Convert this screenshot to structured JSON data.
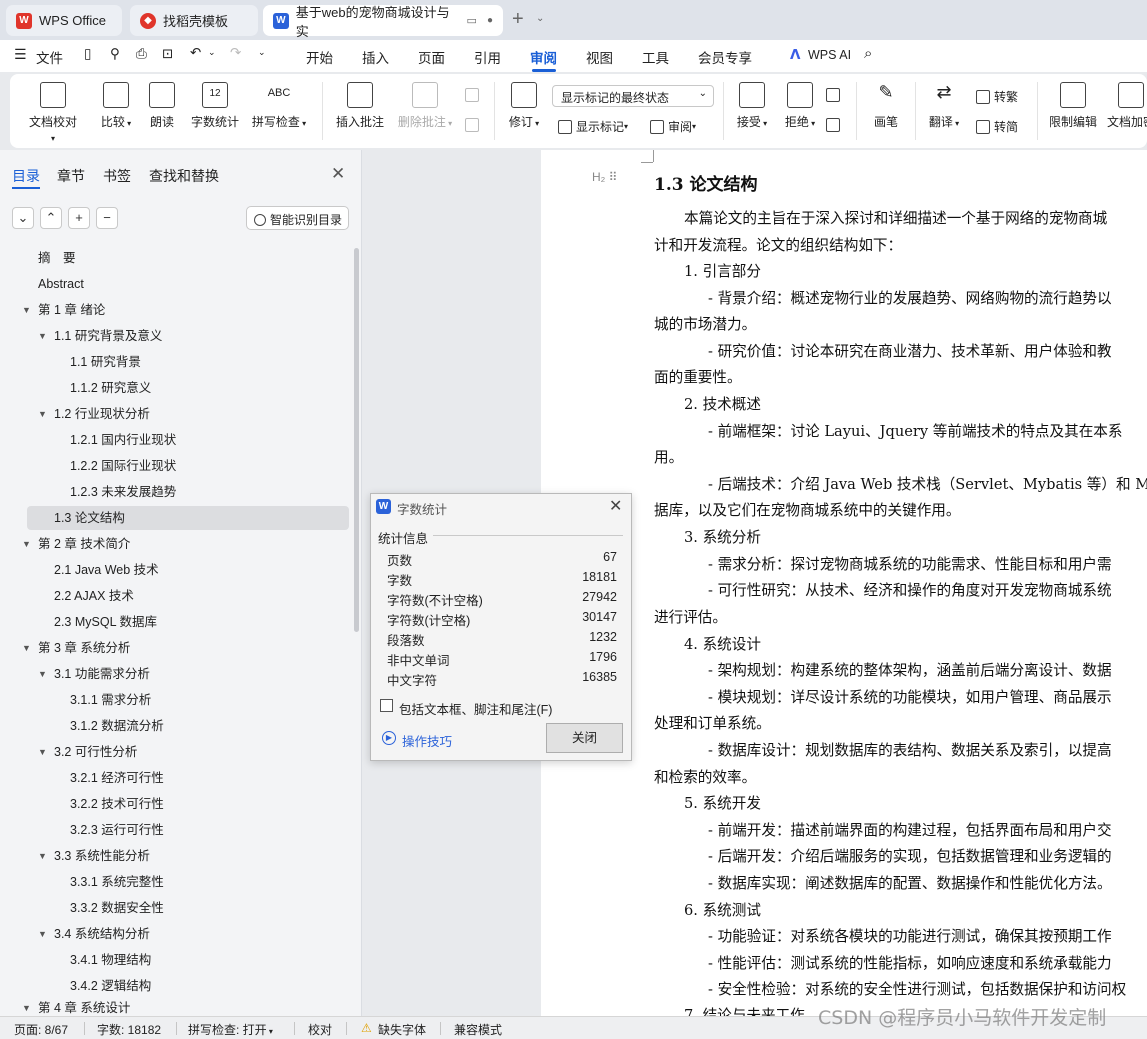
{
  "tabs": {
    "wps": "WPS Office",
    "template": "找稻壳模板",
    "doc": "基于web的宠物商城设计与实"
  },
  "menu": {
    "file": "文件",
    "items": [
      "开始",
      "插入",
      "页面",
      "引用",
      "审阅",
      "视图",
      "工具",
      "会员专享"
    ],
    "active": "审阅",
    "wps_ai": "WPS AI"
  },
  "ribbon": {
    "doc_check": "文档校对",
    "compare": "比较",
    "read_aloud": "朗读",
    "word_count": "字数统计",
    "spell_check": "拼写检查",
    "insert_comment": "插入批注",
    "delete_comment": "删除批注",
    "revise": "修订",
    "markup_select": "显示标记的最终状态",
    "show_markup": "显示标记",
    "review": "审阅",
    "accept": "接受",
    "reject": "拒绝",
    "pen": "画笔",
    "translate": "翻译",
    "to_traditional": "转繁",
    "to_simplified": "转简",
    "restrict_edit": "限制编辑",
    "doc_encrypt": "文档加密"
  },
  "nav": {
    "tabs": [
      "目录",
      "章节",
      "书签",
      "查找和替换"
    ],
    "smart_toc": "智能识别目录",
    "toc": [
      "摘　要",
      "Abstract",
      "第 1 章  绪论",
      "1.1 研究背景及意义",
      "1.1 研究背景",
      "1.1.2 研究意义",
      "1.2  行业现状分析",
      "1.2.1  国内行业现状",
      "1.2.2  国际行业现状",
      "1.2.3  未来发展趋势",
      "1.3 论文结构",
      "第 2 章  技术简介",
      "2.1 Java Web 技术",
      "2.2 AJAX 技术",
      "2.3 MySQL 数据库",
      "第 3 章  系统分析",
      "3.1 功能需求分析",
      "3.1.1 需求分析",
      "3.1.2 数据流分析",
      "3.2 可行性分析",
      "3.2.1 经济可行性",
      "3.2.2 技术可行性",
      "3.2.3  运行可行性",
      "3.3  系统性能分析",
      "3.3.1 系统完整性",
      "3.3.2 数据安全性",
      "3.4 系统结构分析",
      "3.4.1 物理结构",
      "3.4.2 逻辑结构",
      "第 4 章  系统设计"
    ]
  },
  "document": {
    "heading": "1.3 论文结构",
    "lines": [
      "本篇论文的主旨在于深入探讨和详细描述一个基于网络的宠物商城",
      "计和开发流程。论文的组织结构如下：",
      "1.  引言部分",
      "- 背景介绍：概述宠物行业的发展趋势、网络购物的流行趋势以",
      "城的市场潜力。",
      "- 研究价值：讨论本研究在商业潜力、技术革新、用户体验和教",
      "面的重要性。",
      "2.  技术概述",
      "- 前端框架：讨论 Layui、Jquery 等前端技术的特点及其在本系",
      "用。",
      "- 后端技术：介绍 Java Web 技术栈（Servlet、Mybatis 等）和 M",
      "据库，以及它们在宠物商城系统中的关键作用。",
      "3.  系统分析",
      "- 需求分析：探讨宠物商城系统的功能需求、性能目标和用户需",
      "- 可行性研究：从技术、经济和操作的角度对开发宠物商城系统",
      "进行评估。",
      "4.  系统设计",
      "- 架构规划：构建系统的整体架构，涵盖前后端分离设计、数据",
      "- 模块规划：详尽设计系统的功能模块，如用户管理、商品展示",
      "处理和订单系统。",
      "- 数据库设计：规划数据库的表结构、数据关系及索引，以提高",
      "和检索的效率。",
      "5.  系统开发",
      "- 前端开发：描述前端界面的构建过程，包括界面布局和用户交",
      "- 后端开发：介绍后端服务的实现，包括数据管理和业务逻辑的",
      "- 数据库实现：阐述数据库的配置、数据操作和性能优化方法。",
      "6.  系统测试",
      "- 功能验证：对系统各模块的功能进行测试，确保其按预期工作",
      "- 性能评估：测试系统的性能指标，如响应速度和系统承载能力",
      "- 安全性检验：对系统的安全性进行测试，包括数据保护和访问权",
      "7.  结论与未来工作"
    ]
  },
  "wordcount": {
    "title": "字数统计",
    "section": "统计信息",
    "rows": [
      {
        "label": "页数",
        "value": "67"
      },
      {
        "label": "字数",
        "value": "18181"
      },
      {
        "label": "字符数(不计空格)",
        "value": "27942"
      },
      {
        "label": "字符数(计空格)",
        "value": "30147"
      },
      {
        "label": "段落数",
        "value": "1232"
      },
      {
        "label": "非中文单词",
        "value": "1796"
      },
      {
        "label": "中文字符",
        "value": "16385"
      }
    ],
    "include_label": "包括文本框、脚注和尾注(F)",
    "tips": "操作技巧",
    "close": "关闭"
  },
  "status": {
    "page": "页面: 8/67",
    "words": "字数: 18182",
    "spell": "拼写检查: 打开",
    "proofread": "校对",
    "missing_font": "缺失字体",
    "compat": "兼容模式"
  },
  "watermark": "CSDN @程序员小马软件开发定制",
  "colors": {
    "accent": "#1a5fd6",
    "wps_red": "#e0352b",
    "doc_blue": "#2b62d9"
  }
}
